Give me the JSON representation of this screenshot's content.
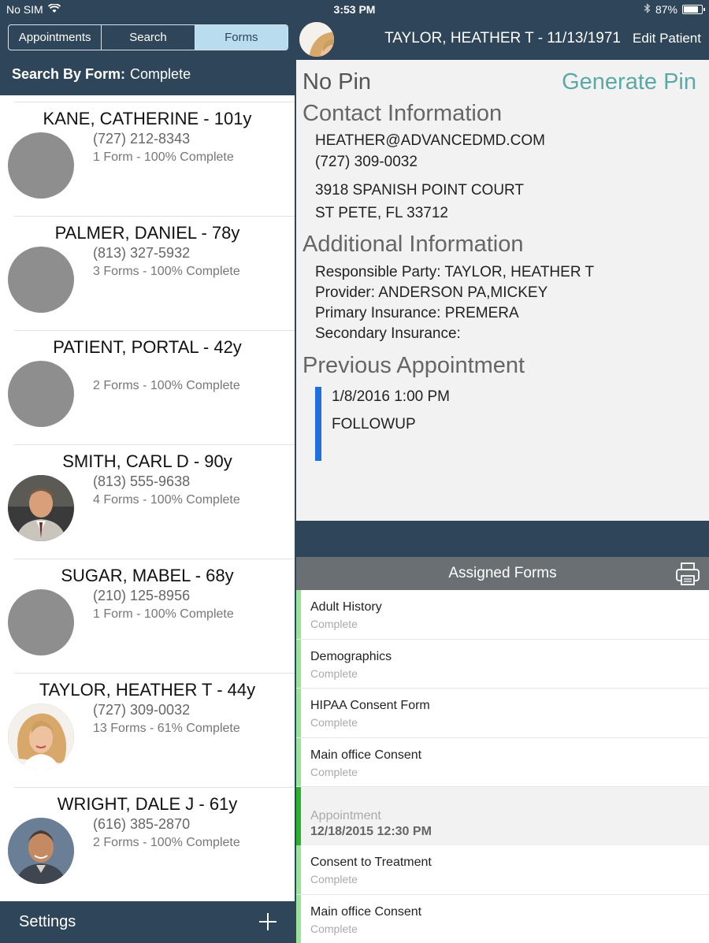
{
  "status_bar": {
    "carrier": "No SIM",
    "time": "3:53 PM",
    "battery": "87%",
    "battery_level": 0.87
  },
  "left": {
    "tabs": [
      {
        "label": "Appointments",
        "active": false
      },
      {
        "label": "Search",
        "active": false
      },
      {
        "label": "Forms",
        "active": true
      }
    ],
    "search_by_label": "Search By Form:",
    "search_by_value": "Complete",
    "patients": [
      {
        "name": "KANE, CATHERINE - 101y",
        "phone": "(727) 212-8343",
        "forms": "1 Form - 100% Complete",
        "avatar": "placeholder"
      },
      {
        "name": "PALMER, DANIEL - 78y",
        "phone": "(813) 327-5932",
        "forms": "3 Forms - 100% Complete",
        "avatar": "placeholder"
      },
      {
        "name": "PATIENT, PORTAL - 42y",
        "phone": "",
        "forms": "2 Forms - 100% Complete",
        "avatar": "placeholder"
      },
      {
        "name": "SMITH, CARL D - 90y",
        "phone": "(813) 555-9638",
        "forms": "4 Forms - 100% Complete",
        "avatar": "man-photo"
      },
      {
        "name": "SUGAR, MABEL - 68y",
        "phone": "(210) 125-8956",
        "forms": "1 Form - 100% Complete",
        "avatar": "placeholder"
      },
      {
        "name": "TAYLOR, HEATHER T - 44y",
        "phone": "(727) 309-0032",
        "forms": "13 Forms - 61% Complete",
        "avatar": "woman-photo"
      },
      {
        "name": "WRIGHT, DALE J - 61y",
        "phone": "(616) 385-2870",
        "forms": "2 Forms - 100% Complete",
        "avatar": "older-man-photo"
      }
    ],
    "footer": {
      "settings_label": "Settings",
      "add_icon": "plus-icon"
    }
  },
  "right": {
    "header": {
      "title": "TAYLOR, HEATHER T - 11/13/1971",
      "edit_label": "Edit Patient"
    },
    "no_pin": "No Pin",
    "generate_pin": "Generate Pin",
    "contact_title": "Contact Information",
    "email": "HEATHER@ADVANCEDMD.COM",
    "phone": "(727) 309-0032",
    "address1": "3918 SPANISH POINT COURT",
    "address2": "ST PETE, FL 33712",
    "additional_title": "Additional Information",
    "responsible_party": "Responsible Party:  TAYLOR, HEATHER T",
    "provider": "Provider:  ANDERSON PA,MICKEY",
    "primary_insurance": "Primary Insurance:  PREMERA",
    "secondary_insurance": "Secondary Insurance:",
    "previous_title": "Previous Appointment",
    "previous_datetime": "1/8/2016 1:00 PM",
    "previous_type": "FOLLOWUP",
    "assigned_forms_title": "Assigned Forms",
    "forms_group1": [
      {
        "name": "Adult History",
        "status": "Complete"
      },
      {
        "name": "Demographics",
        "status": "Complete"
      },
      {
        "name": "HIPAA Consent Form",
        "status": "Complete"
      },
      {
        "name": "Main office Consent",
        "status": "Complete"
      }
    ],
    "appointment_label": "Appointment",
    "appointment_date": "12/18/2015 12:30 PM",
    "forms_group2": [
      {
        "name": "Consent to Treatment",
        "status": "Complete"
      },
      {
        "name": "Main office Consent",
        "status": "Complete"
      }
    ]
  },
  "colors": {
    "nav": "#2f4559",
    "accent_pin": "#5aa9a6",
    "appointment_bar": "#1f6fdf",
    "complete_strip": "#9be39a"
  }
}
